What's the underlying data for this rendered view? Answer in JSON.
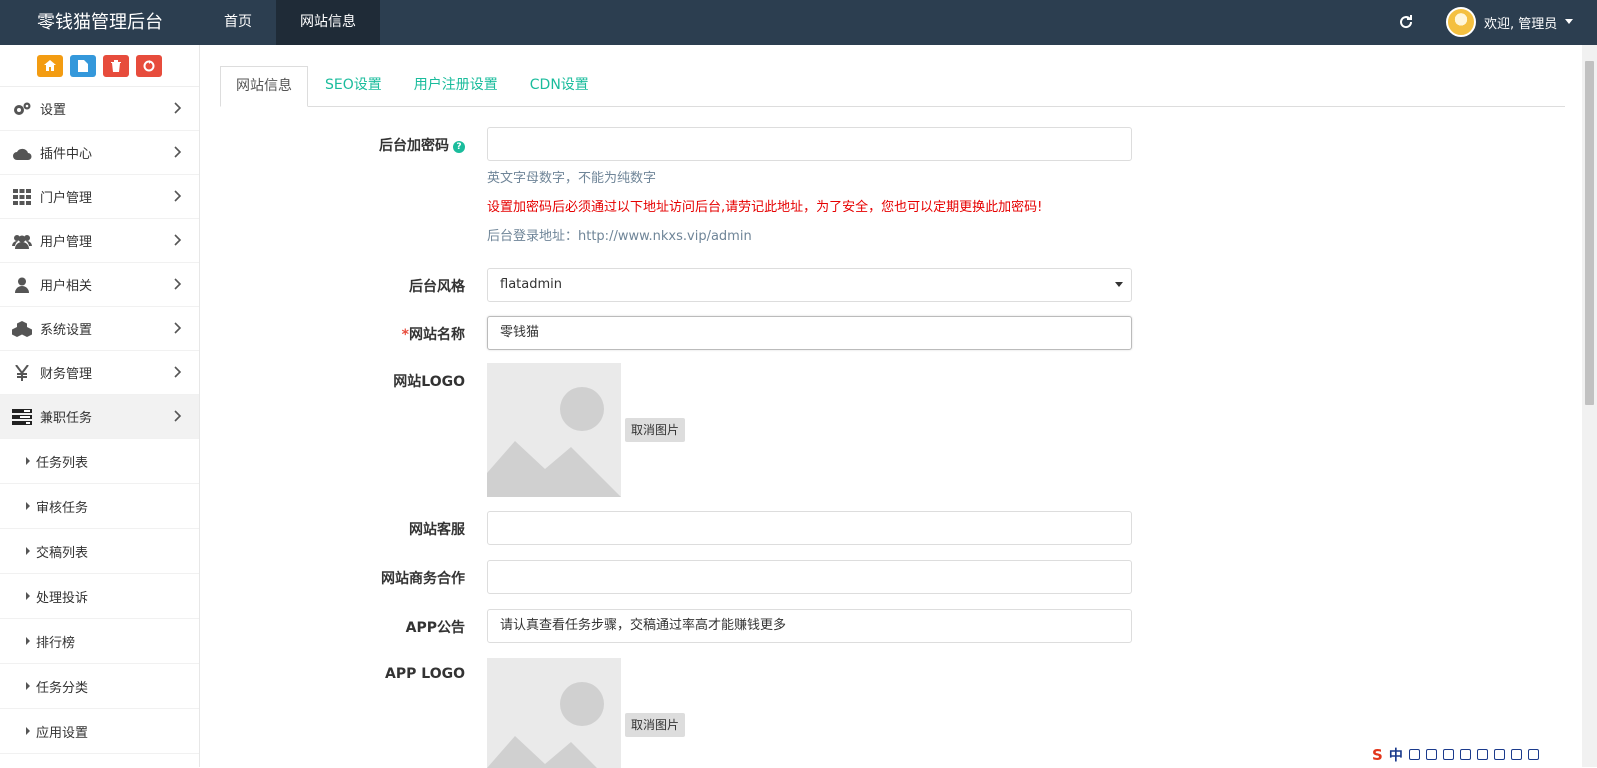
{
  "header": {
    "brand": "零钱猫管理后台",
    "nav": [
      {
        "label": "首页",
        "active": false
      },
      {
        "label": "网站信息",
        "active": true
      }
    ],
    "user_greeting": "欢迎, 管理员",
    "icons": {
      "refresh": "refresh-icon",
      "user_caret": "caret-down-icon"
    }
  },
  "sidebar": {
    "quick_buttons": [
      {
        "icon": "home-icon",
        "color": "#f39c12"
      },
      {
        "icon": "file-icon",
        "color": "#3498db"
      },
      {
        "icon": "trash-icon",
        "color": "#e74c3c"
      },
      {
        "icon": "recycle-icon",
        "color": "#e74c3c"
      }
    ],
    "items": [
      {
        "label": "设置",
        "icon": "gears-icon"
      },
      {
        "label": "插件中心",
        "icon": "cloud-icon"
      },
      {
        "label": "门户管理",
        "icon": "grid-icon"
      },
      {
        "label": "用户管理",
        "icon": "users-icon"
      },
      {
        "label": "用户相关",
        "icon": "user-icon"
      },
      {
        "label": "系统设置",
        "icon": "cubes-icon"
      },
      {
        "label": "财务管理",
        "icon": "yen-icon"
      },
      {
        "label": "兼职任务",
        "icon": "tasks-icon",
        "active": true
      }
    ],
    "subitems": [
      {
        "label": "任务列表"
      },
      {
        "label": "审核任务"
      },
      {
        "label": "交稿列表"
      },
      {
        "label": "处理投诉"
      },
      {
        "label": "排行榜"
      },
      {
        "label": "任务分类"
      },
      {
        "label": "应用设置"
      }
    ]
  },
  "tabs": [
    {
      "label": "网站信息",
      "active": true
    },
    {
      "label": "SEO设置",
      "active": false
    },
    {
      "label": "用户注册设置",
      "active": false
    },
    {
      "label": "CDN设置",
      "active": false
    }
  ],
  "form": {
    "admin_password": {
      "label": "后台加密码",
      "value": "",
      "help": "英文字母数字，不能为纯数字",
      "warning": "设置加密码后必须通过以下地址访问后台,请劳记此地址，为了安全，您也可以定期更换此加密码!",
      "login_url": "后台登录地址：http://www.nkxs.vip/admin"
    },
    "admin_style": {
      "label": "后台风格",
      "value": "flatadmin"
    },
    "site_name": {
      "required_mark": "*",
      "label": "网站名称",
      "value": "零钱猫"
    },
    "site_logo": {
      "label": "网站LOGO",
      "cancel_label": "取消图片"
    },
    "site_service": {
      "label": "网站客服",
      "value": ""
    },
    "site_business": {
      "label": "网站商务合作",
      "value": ""
    },
    "app_notice": {
      "label": "APP公告",
      "value": "请认真查看任务步骤，交稿通过率高才能赚钱更多"
    },
    "app_logo": {
      "label": "APP LOGO",
      "cancel_label": "取消图片"
    }
  },
  "ime": {
    "logo": "S",
    "mode": "中"
  },
  "colors": {
    "header_bg": "#2c3e50",
    "accent": "#1abc9c",
    "warning": "#e60000"
  }
}
